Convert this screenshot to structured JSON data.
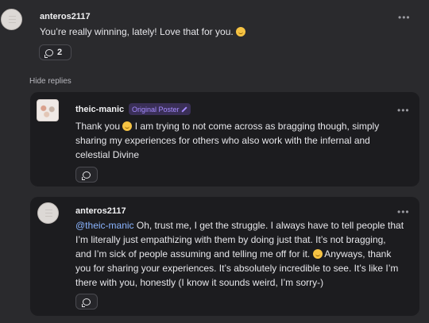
{
  "comments": [
    {
      "username": "anteros2117",
      "text": "You’re really winning, lately! Love that for you.",
      "emoji": "grinning-face",
      "reply_count": "2"
    },
    {
      "username": "theic-manic",
      "badge": "Original Poster",
      "text_before_emoji": "Thank you",
      "emoji": "smiling-face",
      "line1_rest": " I am trying to not come across as bragging though, simply",
      "line2": "sharing my experiences for others who also work with the infernal and",
      "line3": "celestial Divine"
    },
    {
      "username": "anteros2117",
      "mention": "@theic-manic",
      "line1": " Oh, trust me, I get the struggle. I always have to tell people that",
      "line2": "I’m literally just empathizing with them by doing just that. It’s not bragging,",
      "line3_before_emoji": "and I’m sick of people assuming and telling me off for it.",
      "emoji": "grinning-face",
      "line3_after_emoji": " Anyways, thank",
      "line4": "you for sharing your experiences. It’s absolutely incredible to see. It’s like I’m",
      "line5": "there with you, honestly (I know it sounds weird, I’m sorry-)"
    }
  ],
  "hide_replies": "Hide replies",
  "more_label": "•••"
}
